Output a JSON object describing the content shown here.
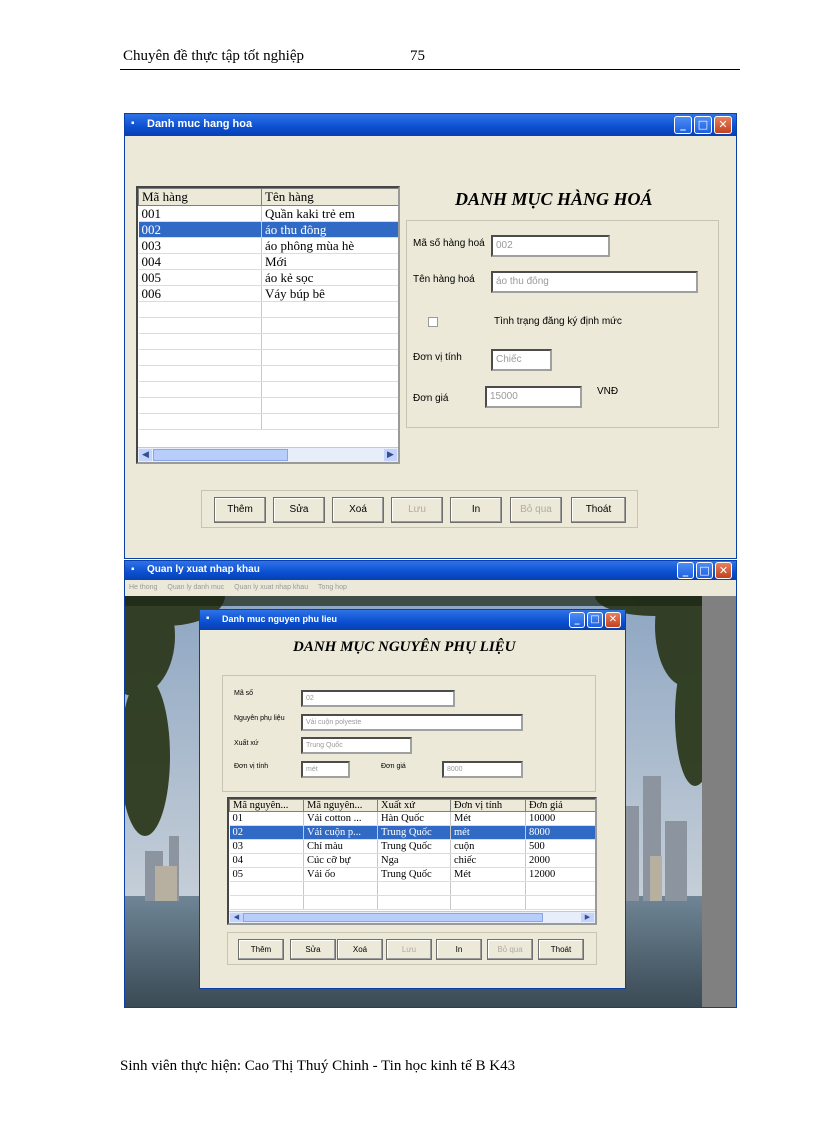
{
  "page": {
    "header_left": "Chuyên đề thực tập tốt nghiệp",
    "page_number": "75",
    "footer": "Sinh viên thực hiện: Cao Thị Thuý Chinh - Tin học kinh tế B K43"
  },
  "window1": {
    "title": "Danh muc hang hoa",
    "heading": "DANH MỤC HÀNG HOÁ",
    "grid": {
      "headers": [
        "Mã hàng",
        "Tên hàng"
      ],
      "rows": [
        [
          "001",
          "Quần kaki trẻ em"
        ],
        [
          "002",
          "áo thu đông"
        ],
        [
          "003",
          "áo phông mùa hè"
        ],
        [
          "004",
          "Mới"
        ],
        [
          "005",
          "áo kẻ sọc"
        ],
        [
          "006",
          "Váy búp bê"
        ]
      ],
      "selected_row": 1
    },
    "form": {
      "ma_label": "Mã số hàng hoá",
      "ma_value": "002",
      "ten_label": "Tên hàng hoá",
      "ten_value": "áo thu đông",
      "checkbox_label": "Tình trạng đăng ký định mức",
      "donvi_label": "Đơn vị tính",
      "donvi_value": "Chiếc",
      "dongia_label": "Đơn giá",
      "dongia_value": "15000",
      "currency": "VNĐ"
    },
    "buttons": {
      "them": "Thêm",
      "sua": "Sửa",
      "xoa": "Xoá",
      "luu": "Lưu",
      "in": "In",
      "boqua": "Bỏ qua",
      "thoat": "Thoát"
    }
  },
  "window2": {
    "title": "Quan ly xuat nhap khau",
    "menu": [
      "He thong",
      "Quan ly danh muc",
      "Quan ly xuat nhap khau",
      "Tong hop"
    ]
  },
  "window3": {
    "title": "Danh muc nguyen phu lieu",
    "heading": "DANH MỤC NGUYÊN PHỤ LIỆU",
    "form": {
      "maso_label": "Mã số",
      "maso_value": "02",
      "npl_label": "Nguyên phụ liệu",
      "npl_value": "Vải cuộn polyeste",
      "xuatxu_label": "Xuất xứ",
      "xuatxu_value": "Trung Quốc",
      "donvi_label": "Đơn vị tính",
      "donvi_value": "mét",
      "dongia_label": "Đơn giá",
      "dongia_value": "8000"
    },
    "grid": {
      "headers": [
        "Mã nguyên...",
        "Mã nguyên...",
        "Xuất xứ",
        "Đơn vị tính",
        "Đơn giá"
      ],
      "rows": [
        [
          "01",
          "Vải cotton ...",
          "Hàn Quốc",
          "Mét",
          "10000"
        ],
        [
          "02",
          "Vải cuộn p...",
          "Trung Quốc",
          "mét",
          "8000"
        ],
        [
          "03",
          "Chỉ màu",
          "Trung Quốc",
          "cuộn",
          "500"
        ],
        [
          "04",
          "Cúc cỡ bự",
          "Nga",
          "chiếc",
          "2000"
        ],
        [
          "05",
          "Vải ốo",
          "Trung Quốc",
          "Mét",
          "12000"
        ]
      ],
      "selected_row": 1
    },
    "buttons": {
      "them": "Thêm",
      "sua": "Sửa",
      "xoa": "Xoá",
      "luu": "Lưu",
      "in": "In",
      "boqua": "Bỏ qua",
      "thoat": "Thoát"
    }
  }
}
